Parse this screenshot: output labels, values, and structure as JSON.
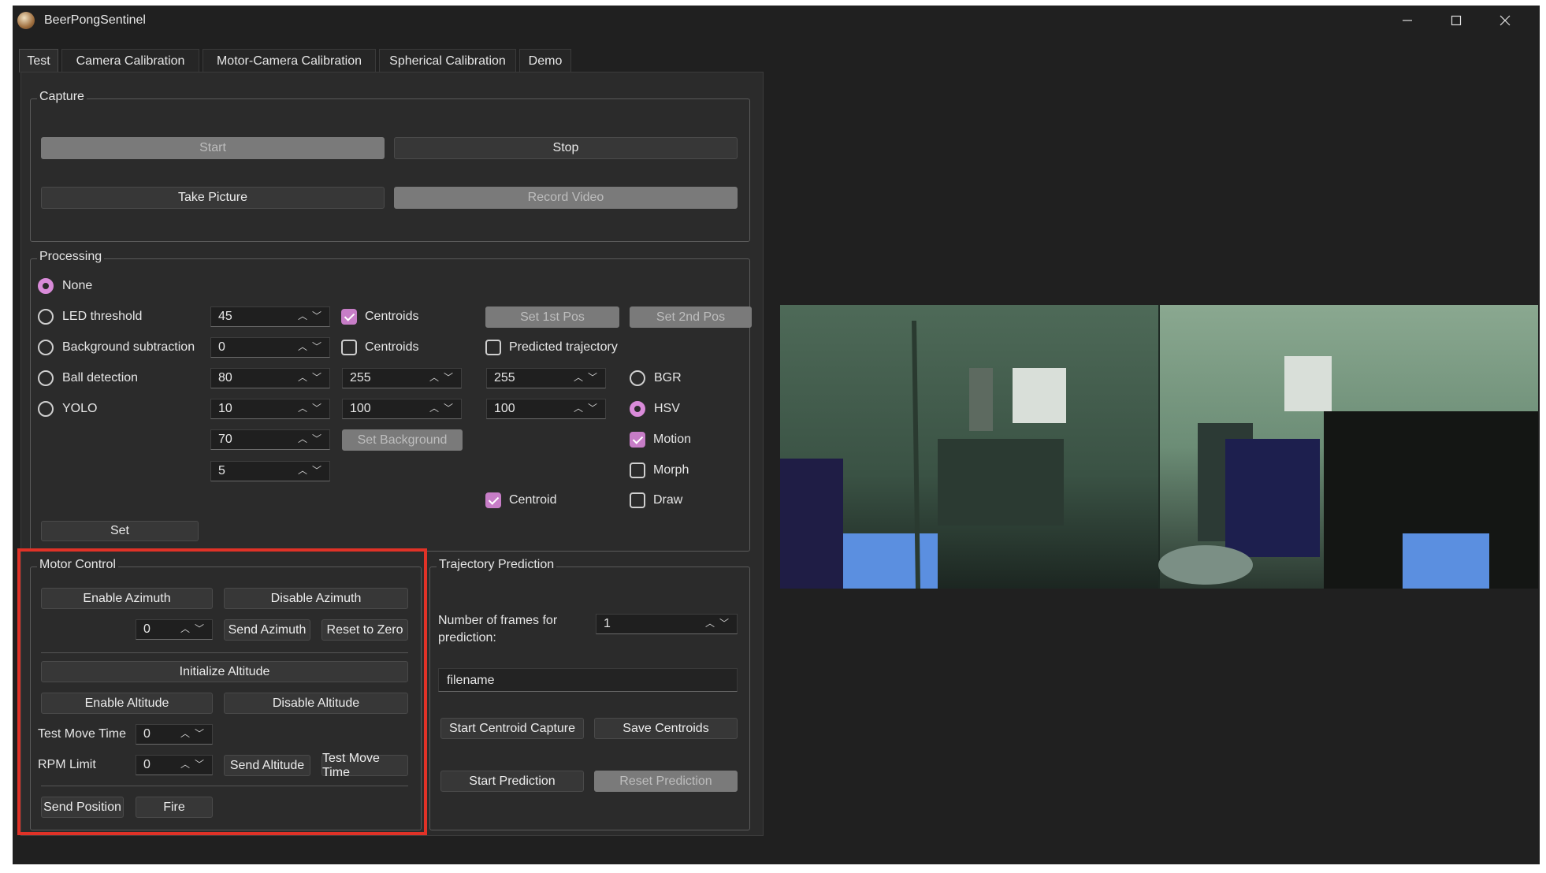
{
  "window": {
    "title": "BeerPongSentinel"
  },
  "tabs": [
    "Test",
    "Camera Calibration",
    "Motor-Camera Calibration",
    "Spherical Calibration",
    "Demo"
  ],
  "capture": {
    "label": "Capture",
    "start": "Start",
    "stop": "Stop",
    "take_picture": "Take Picture",
    "record_video": "Record Video"
  },
  "processing": {
    "label": "Processing",
    "radios": {
      "none": "None",
      "led": "LED threshold",
      "bgsub": "Background subtraction",
      "ball": "Ball detection",
      "yolo": "YOLO"
    },
    "selected": "None",
    "spins": {
      "led": "45",
      "bgsub": "0",
      "ball1": "80",
      "ball2": "255",
      "ball3": "255",
      "yolo1": "10",
      "yolo2": "100",
      "yolo3": "100",
      "r5": "70",
      "r6": "5"
    },
    "centroids1": "Centroids",
    "centroids2": "Centroids",
    "predicted": "Predicted trajectory",
    "set1": "Set 1st Pos",
    "set2": "Set 2nd Pos",
    "set_background": "Set Background",
    "bgr": "BGR",
    "hsv": "HSV",
    "motion": "Motion",
    "morph": "Morph",
    "draw": "Draw",
    "centroid": "Centroid",
    "set": "Set"
  },
  "motor": {
    "label": "Motor Control",
    "enable_az": "Enable Azimuth",
    "disable_az": "Disable Azimuth",
    "az_value": "0",
    "send_az": "Send Azimuth",
    "reset_zero": "Reset to Zero",
    "init_alt": "Initialize Altitude",
    "enable_alt": "Enable Altitude",
    "disable_alt": "Disable Altitude",
    "test_move_label": "Test Move Time",
    "test_move_value": "0",
    "rpm_label": "RPM Limit",
    "rpm_value": "0",
    "send_alt": "Send Altitude",
    "test_move_btn": "Test Move Time",
    "send_pos": "Send Position",
    "fire": "Fire"
  },
  "trajectory": {
    "label": "Trajectory Prediction",
    "frames_label_1": "Number of frames for",
    "frames_label_2": "prediction:",
    "frames_value": "1",
    "filename": "filename",
    "start_capture": "Start Centroid Capture",
    "save_centroids": "Save Centroids",
    "start_pred": "Start Prediction",
    "reset_pred": "Reset Prediction"
  },
  "colors": {
    "accent": "#d98bd9",
    "highlight": "#e03227",
    "background": "#202020"
  }
}
